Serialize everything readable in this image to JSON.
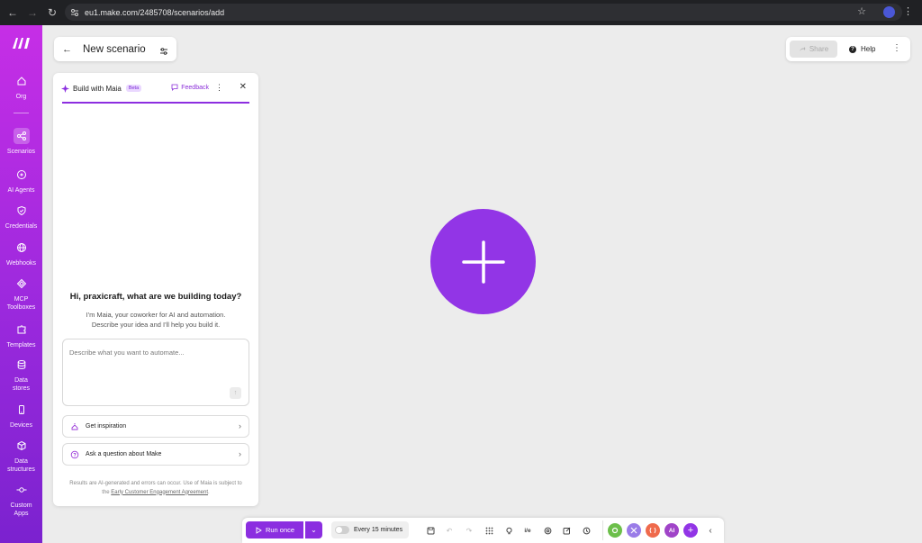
{
  "browser": {
    "url": "eu1.make.com/2485708/scenarios/add"
  },
  "sidebar": {
    "items": [
      {
        "label": "Org"
      },
      {
        "label": "Scenarios"
      },
      {
        "label": "AI Agents"
      },
      {
        "label": "Credentials"
      },
      {
        "label": "Webhooks"
      },
      {
        "label": "MCP Toolboxes"
      },
      {
        "label": "Templates"
      },
      {
        "label": "Data stores"
      },
      {
        "label": "Devices"
      },
      {
        "label": "Data structures"
      },
      {
        "label": "Custom Apps"
      }
    ]
  },
  "header": {
    "title": "New scenario"
  },
  "top_right": {
    "share_label": "Share",
    "help_label": "Help"
  },
  "maia": {
    "title": "Build with Maia",
    "badge": "Beta",
    "feedback_label": "Feedback",
    "greeting": "Hi, praxicraft, what are we building today?",
    "intro_line1": "I'm Maia, your coworker for AI and automation.",
    "intro_line2": "Describe your idea and I'll help you build it.",
    "prompt_placeholder": "Describe what you want to automate...",
    "suggestions": [
      {
        "label": "Get inspiration"
      },
      {
        "label": "Ask a question about Make"
      }
    ],
    "disclaimer_text": "Results are AI-generated and errors can occur. Use of Maia is subject to the",
    "disclaimer_link": "Early Customer Engagement Agreement"
  },
  "toolbar": {
    "run_label": "Run once",
    "schedule_label": "Every 15 minutes",
    "io_label": "i/e",
    "apps": [
      {
        "label": "",
        "color": "#6cbf4a"
      },
      {
        "label": "",
        "color": "#9a7ce8"
      },
      {
        "label": "",
        "color": "#ef6a4c"
      },
      {
        "label": "AI",
        "color": "#a044c8"
      }
    ]
  },
  "colors": {
    "brand": "#9235e6",
    "sidebar_top": "#c62ee6",
    "sidebar_bottom": "#7b22cf"
  }
}
